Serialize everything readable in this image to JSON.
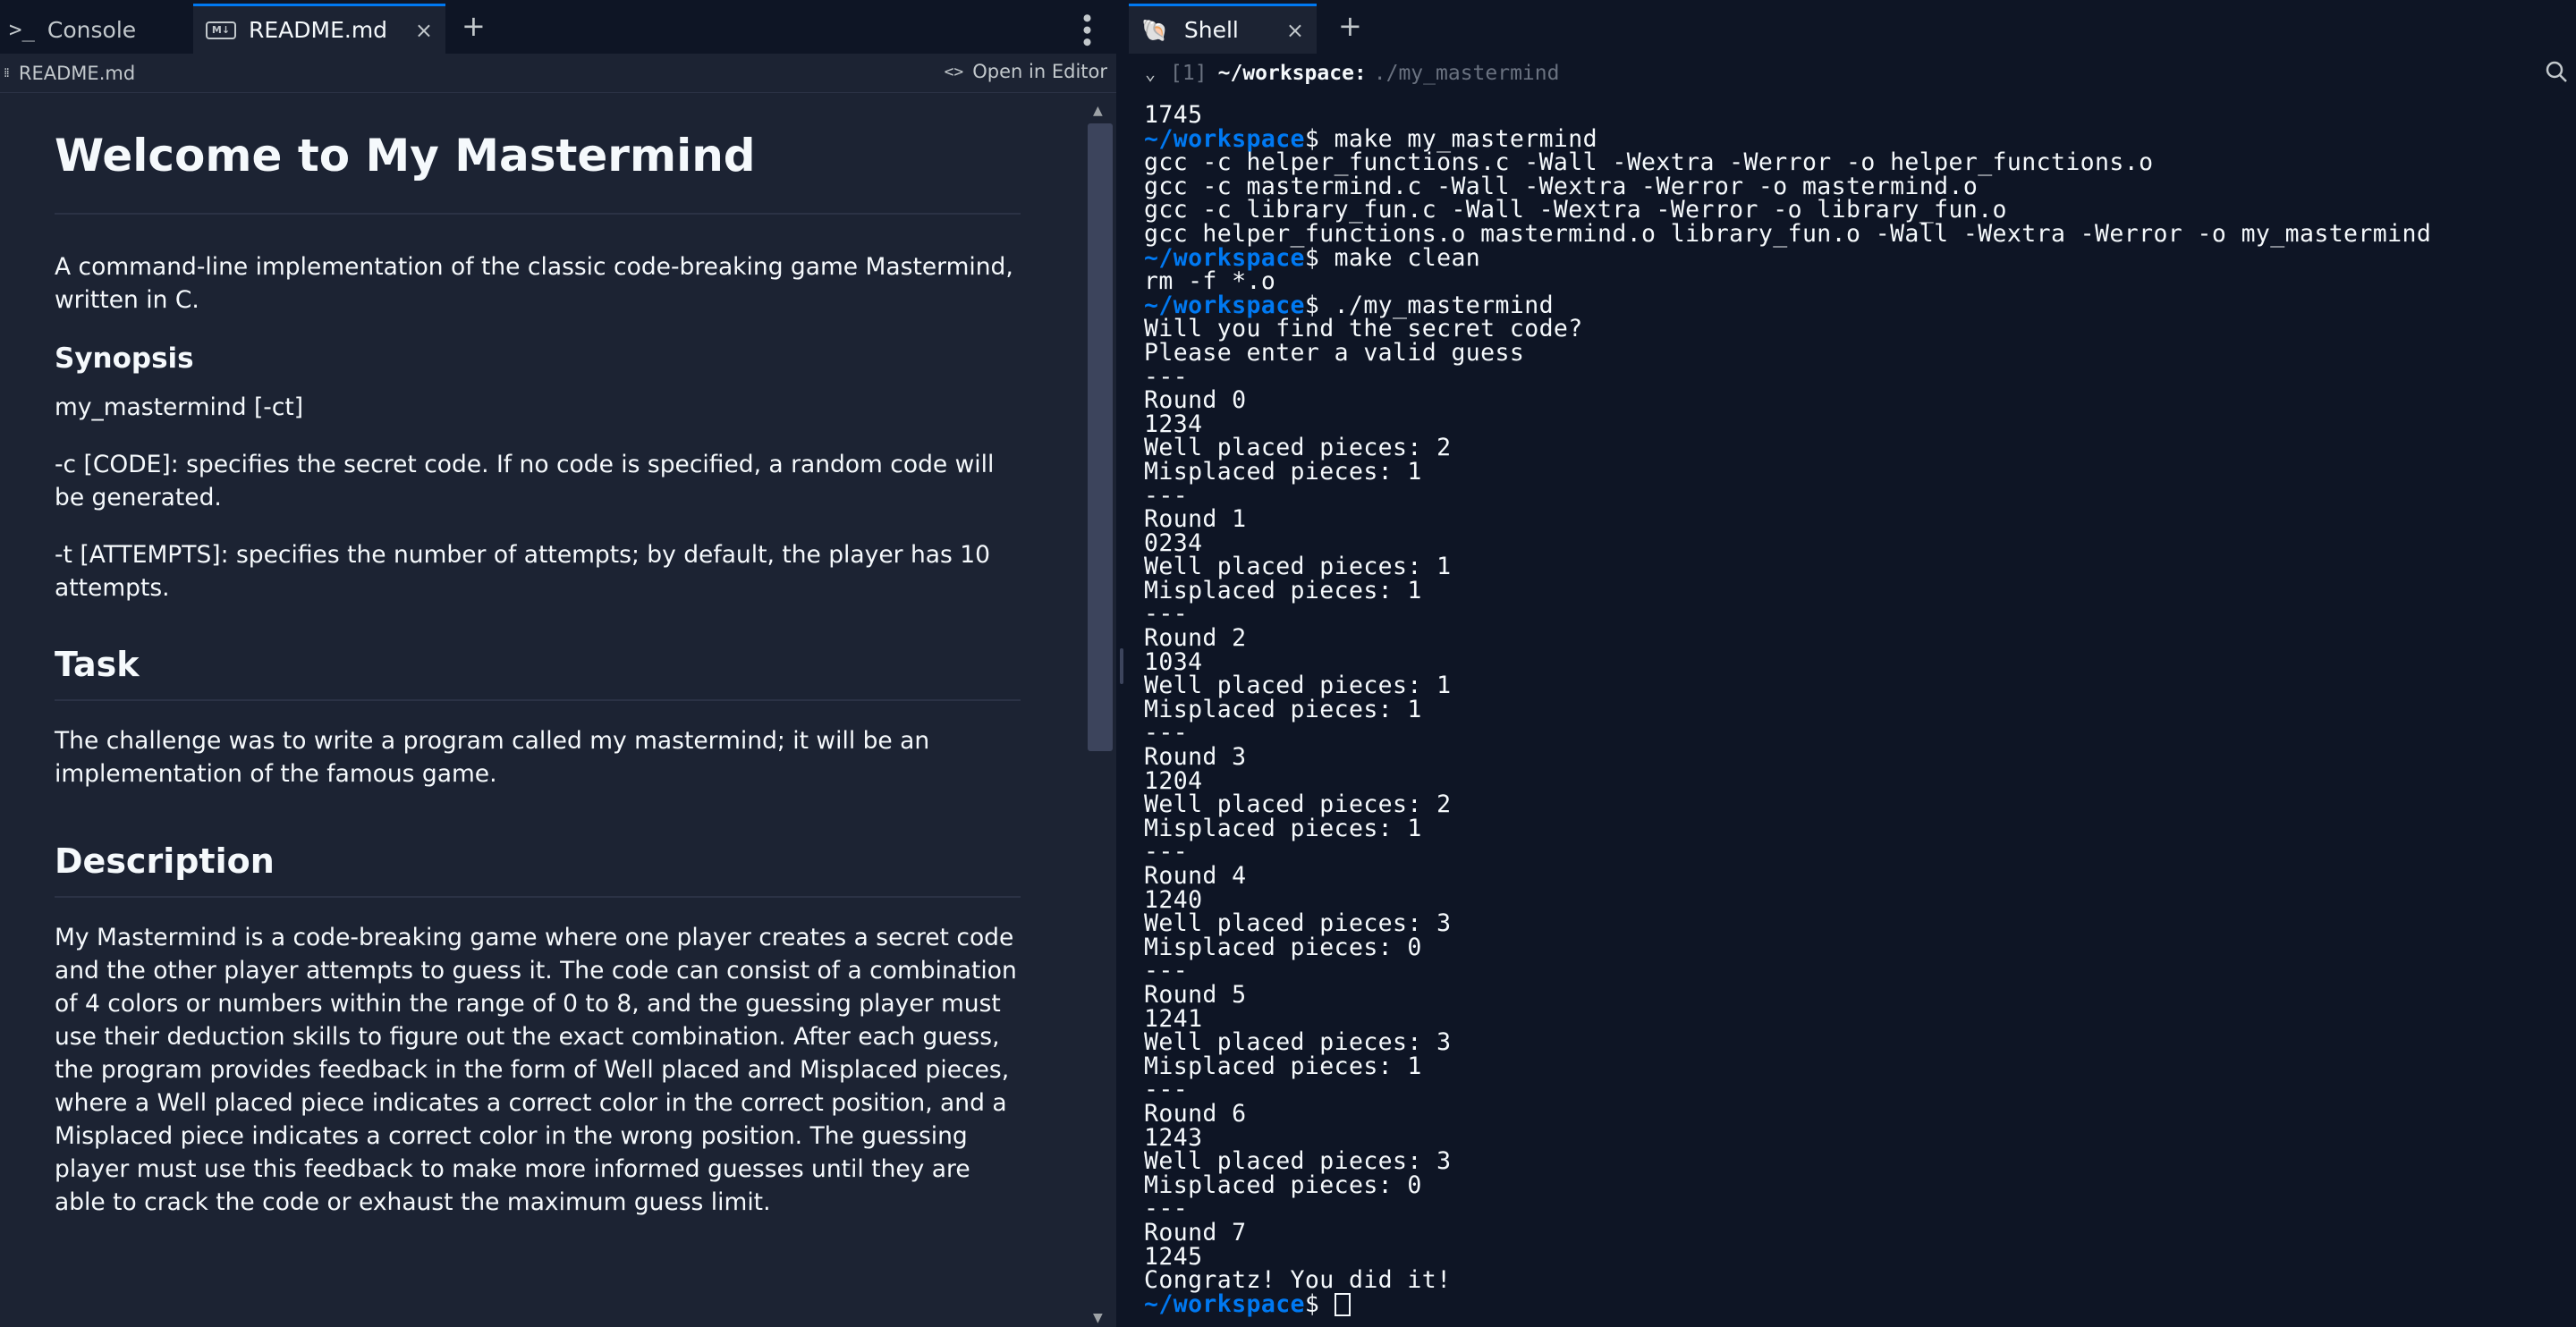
{
  "left_tabs": {
    "console_glyph": ">_",
    "console_label": "Console",
    "readme_icon": "M↓",
    "readme_label": "README.md",
    "close_glyph": "×",
    "add_glyph": "+",
    "more_glyph": "⋮"
  },
  "subbar": {
    "file_label": "README.md",
    "open_editor_glyph": "<>",
    "open_editor_label": "Open in Editor"
  },
  "readme": {
    "title": "Welcome to My Mastermind",
    "intro": "A command-line implementation of the classic code-breaking game Mastermind, written in C.",
    "synopsis_heading": "Synopsis",
    "synopsis_usage": "my_mastermind [-ct]",
    "synopsis_c": "-c [CODE]: specifies the secret code. If no code is specified, a random code will be generated.",
    "synopsis_t": "-t [ATTEMPTS]: specifies the number of attempts; by default, the player has 10 attempts.",
    "task_heading": "Task",
    "task_text": "The challenge was to write a program called my mastermind; it will be an implementation of the famous game.",
    "description_heading": "Description",
    "description_text": "My Mastermind is a code-breaking game where one player creates a secret code and the other player attempts to guess it. The code can consist of a combination of 4 colors or numbers within the range of 0 to 8, and the guessing player must use their deduction skills to figure out the exact combination. After each guess, the program provides feedback in the form of Well placed and Misplaced pieces, where a Well placed piece indicates a correct color in the correct position, and a Misplaced piece indicates a correct color in the wrong position. The guessing player must use this feedback to make more informed guesses until they are able to crack the code or exhaust the maximum guess limit."
  },
  "right_tabs": {
    "shell_icon": "🐚",
    "shell_label": "Shell",
    "close_glyph": "×",
    "add_glyph": "+"
  },
  "shell_header": {
    "chevron": "⌄",
    "index": "[1]",
    "path": "~/workspace:",
    "command": "./my_mastermind",
    "search_glyph": "⌕"
  },
  "terminal": {
    "prompt": "~/workspace",
    "lines": [
      {
        "prompt": false,
        "text": "1745"
      },
      {
        "prompt": true,
        "text": "$ make my_mastermind"
      },
      {
        "prompt": false,
        "text": "gcc -c helper_functions.c -Wall -Wextra -Werror -o helper_functions.o"
      },
      {
        "prompt": false,
        "text": "gcc -c mastermind.c -Wall -Wextra -Werror -o mastermind.o"
      },
      {
        "prompt": false,
        "text": "gcc -c library_fun.c -Wall -Wextra -Werror -o library_fun.o"
      },
      {
        "prompt": false,
        "text": "gcc helper_functions.o mastermind.o library_fun.o -Wall -Wextra -Werror -o my_mastermind"
      },
      {
        "prompt": true,
        "text": "$ make clean"
      },
      {
        "prompt": false,
        "text": "rm -f *.o"
      },
      {
        "prompt": true,
        "text": "$ ./my_mastermind"
      },
      {
        "prompt": false,
        "text": "Will you find the secret code?"
      },
      {
        "prompt": false,
        "text": "Please enter a valid guess"
      },
      {
        "prompt": false,
        "text": "---"
      },
      {
        "prompt": false,
        "text": "Round 0"
      },
      {
        "prompt": false,
        "text": "1234"
      },
      {
        "prompt": false,
        "text": "Well placed pieces: 2"
      },
      {
        "prompt": false,
        "text": "Misplaced pieces: 1"
      },
      {
        "prompt": false,
        "text": "---"
      },
      {
        "prompt": false,
        "text": "Round 1"
      },
      {
        "prompt": false,
        "text": "0234"
      },
      {
        "prompt": false,
        "text": "Well placed pieces: 1"
      },
      {
        "prompt": false,
        "text": "Misplaced pieces: 1"
      },
      {
        "prompt": false,
        "text": "---"
      },
      {
        "prompt": false,
        "text": "Round 2"
      },
      {
        "prompt": false,
        "text": "1034"
      },
      {
        "prompt": false,
        "text": "Well placed pieces: 1"
      },
      {
        "prompt": false,
        "text": "Misplaced pieces: 1"
      },
      {
        "prompt": false,
        "text": "---"
      },
      {
        "prompt": false,
        "text": "Round 3"
      },
      {
        "prompt": false,
        "text": "1204"
      },
      {
        "prompt": false,
        "text": "Well placed pieces: 2"
      },
      {
        "prompt": false,
        "text": "Misplaced pieces: 1"
      },
      {
        "prompt": false,
        "text": "---"
      },
      {
        "prompt": false,
        "text": "Round 4"
      },
      {
        "prompt": false,
        "text": "1240"
      },
      {
        "prompt": false,
        "text": "Well placed pieces: 3"
      },
      {
        "prompt": false,
        "text": "Misplaced pieces: 0"
      },
      {
        "prompt": false,
        "text": "---"
      },
      {
        "prompt": false,
        "text": "Round 5"
      },
      {
        "prompt": false,
        "text": "1241"
      },
      {
        "prompt": false,
        "text": "Well placed pieces: 3"
      },
      {
        "prompt": false,
        "text": "Misplaced pieces: 1"
      },
      {
        "prompt": false,
        "text": "---"
      },
      {
        "prompt": false,
        "text": "Round 6"
      },
      {
        "prompt": false,
        "text": "1243"
      },
      {
        "prompt": false,
        "text": "Well placed pieces: 3"
      },
      {
        "prompt": false,
        "text": "Misplaced pieces: 0"
      },
      {
        "prompt": false,
        "text": "---"
      },
      {
        "prompt": false,
        "text": "Round 7"
      },
      {
        "prompt": false,
        "text": "1245"
      },
      {
        "prompt": false,
        "text": "Congratz! You did it!"
      },
      {
        "prompt": true,
        "text": "$ ",
        "cursor": true
      }
    ]
  },
  "colors": {
    "background": "#0e1525",
    "panel": "#1c2333",
    "accent": "#0079f2",
    "text": "#f5f9fc",
    "muted": "#c2c8cc"
  }
}
